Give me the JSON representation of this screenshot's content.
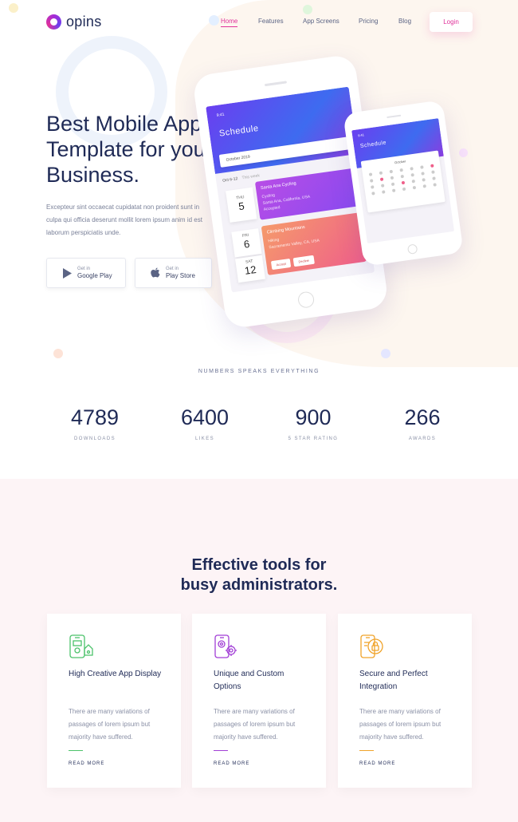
{
  "brand": {
    "name": "opins"
  },
  "nav": {
    "items": [
      {
        "label": "Home",
        "active": true
      },
      {
        "label": "Features",
        "active": false
      },
      {
        "label": "App Screens",
        "active": false
      },
      {
        "label": "Pricing",
        "active": false
      },
      {
        "label": "Blog",
        "active": false
      }
    ],
    "login_label": "Login"
  },
  "hero": {
    "title": "Best Mobile App Template for your Business.",
    "description": "Excepteur sint occaecat cupidatat non proident sunt in culpa qui officia deserunt mollit lorem ipsum anim id est laborum perspiciatis unde.",
    "buttons": [
      {
        "small": "Get in",
        "big": "Google Play",
        "icon": "play-icon"
      },
      {
        "small": "Get in",
        "big": "Play Store",
        "icon": "apple-icon"
      }
    ]
  },
  "phone_main": {
    "time": "9:41",
    "title": "Schedule",
    "month": "October 2019",
    "range": "Oct 6-12",
    "range_note": "This week",
    "day1": {
      "weekday": "THU",
      "date": "5"
    },
    "day2": {
      "weekday": "FRI",
      "date": "6"
    },
    "day3": {
      "weekday": "SAT",
      "date": "12"
    },
    "event1": {
      "title": "Santa Ana Cycling",
      "line1": "Cycling",
      "line2": "Santa Ana, California, USA",
      "line3": "Accepted"
    },
    "event2": {
      "title": "Climbing Mountains",
      "line1": "Hiking",
      "line2": "Sacramento Valley, CA, USA",
      "accept": "Accept",
      "decline": "Decline"
    }
  },
  "phone_small": {
    "title": "Schedule",
    "month": "October"
  },
  "numbers": {
    "heading": "NUMBERS SPEAKS EVERYTHING",
    "stats": [
      {
        "value": "4789",
        "label": "DOWNLOADS"
      },
      {
        "value": "6400",
        "label": "LIKES"
      },
      {
        "value": "900",
        "label": "5 STAR RATING"
      },
      {
        "value": "266",
        "label": "AWARDS"
      }
    ]
  },
  "tools": {
    "title_line1": "Effective tools for",
    "title_line2": "busy administrators.",
    "features": [
      {
        "icon": "app-display-icon",
        "title": "High Creative App Display",
        "desc": "There are many variations of passages of lorem ipsum but majority have suffered.",
        "link": "READ MORE",
        "color": "#4cc26b"
      },
      {
        "icon": "gear-phone-icon",
        "title": "Unique and Custom Options",
        "desc": "There are many variations of passages of lorem ipsum but majority have suffered.",
        "link": "READ MORE",
        "color": "#a23fd6"
      },
      {
        "icon": "lock-phone-icon",
        "title": "Secure and Perfect Integration",
        "desc": "There are many variations of passages of lorem ipsum but majority have suffered.",
        "link": "READ MORE",
        "color": "#f0a32a"
      }
    ]
  },
  "colors": {
    "accent": "#e0319a",
    "heading": "#1f2a56"
  }
}
